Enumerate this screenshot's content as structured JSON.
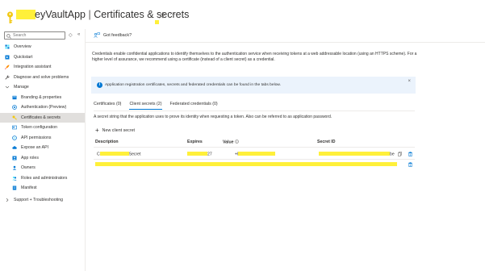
{
  "header": {
    "title_suffix": "eyVaultApp",
    "separator": "|",
    "section": "Certificates & secrets",
    "more": "···"
  },
  "sidebar": {
    "search_placeholder": "Search",
    "collapse_up": "◇",
    "collapse_left": "«",
    "items": [
      {
        "label": "Overview",
        "icon": "overview-icon",
        "indent": 0
      },
      {
        "label": "Quickstart",
        "icon": "quickstart-icon",
        "indent": 0
      },
      {
        "label": "Integration assistant",
        "icon": "rocket-icon",
        "indent": 0
      },
      {
        "label": "Diagnose and solve problems",
        "icon": "wrench-icon",
        "indent": 0
      },
      {
        "label": "Manage",
        "icon": "chevron-down-icon",
        "indent": 0
      },
      {
        "label": "Branding & properties",
        "icon": "branding-icon",
        "indent": 1
      },
      {
        "label": "Authentication (Preview)",
        "icon": "authentication-icon",
        "indent": 1
      },
      {
        "label": "Certificates & secrets",
        "icon": "key-icon",
        "indent": 1,
        "active": true
      },
      {
        "label": "Token configuration",
        "icon": "token-icon",
        "indent": 1
      },
      {
        "label": "API permissions",
        "icon": "api-permissions-icon",
        "indent": 1
      },
      {
        "label": "Expose an API",
        "icon": "cloud-icon",
        "indent": 1
      },
      {
        "label": "App roles",
        "icon": "app-roles-icon",
        "indent": 1
      },
      {
        "label": "Owners",
        "icon": "owners-icon",
        "indent": 1
      },
      {
        "label": "Roles and administrators",
        "icon": "roles-icon",
        "indent": 1
      },
      {
        "label": "Manifest",
        "icon": "manifest-icon",
        "indent": 1
      },
      {
        "label": "Support + Troubleshooting",
        "icon": "chevron-right-icon",
        "indent": 0
      }
    ]
  },
  "toolbar": {
    "feedback_label": "Got feedback?"
  },
  "main": {
    "description": "Credentials enable confidential applications to identify themselves to the authentication service when receiving tokens at a web addressable location (using an HTTPS scheme). For a higher level of assurance, we recommend using a certificate (instead of a client secret) as a credential.",
    "info_text": "Application registration certificates, secrets and federated credentials can be found in the tabs below.",
    "info_close": "×",
    "tabs": [
      {
        "label": "Certificates (0)"
      },
      {
        "label": "Client secrets (2)",
        "active": true
      },
      {
        "label": "Federated credentials (0)"
      }
    ],
    "sub_description": "A secret string that the application uses to prove its identity when requesting a token. Also can be referred to as application password.",
    "new_secret_label": "New client secret",
    "table": {
      "headers": [
        "Description",
        "Expires",
        "Value",
        "Secret ID"
      ],
      "rows": [
        {
          "description_prefix": "C",
          "description_suffix": "Secret",
          "expires_suffix": "27",
          "value_prefix": "+I",
          "secret_id_suffix": "be"
        }
      ]
    }
  },
  "colors": {
    "accent": "#0078d4",
    "redaction": "#fff03a",
    "key_icon": "#f2c811",
    "info_bg": "#ebf3fc"
  }
}
